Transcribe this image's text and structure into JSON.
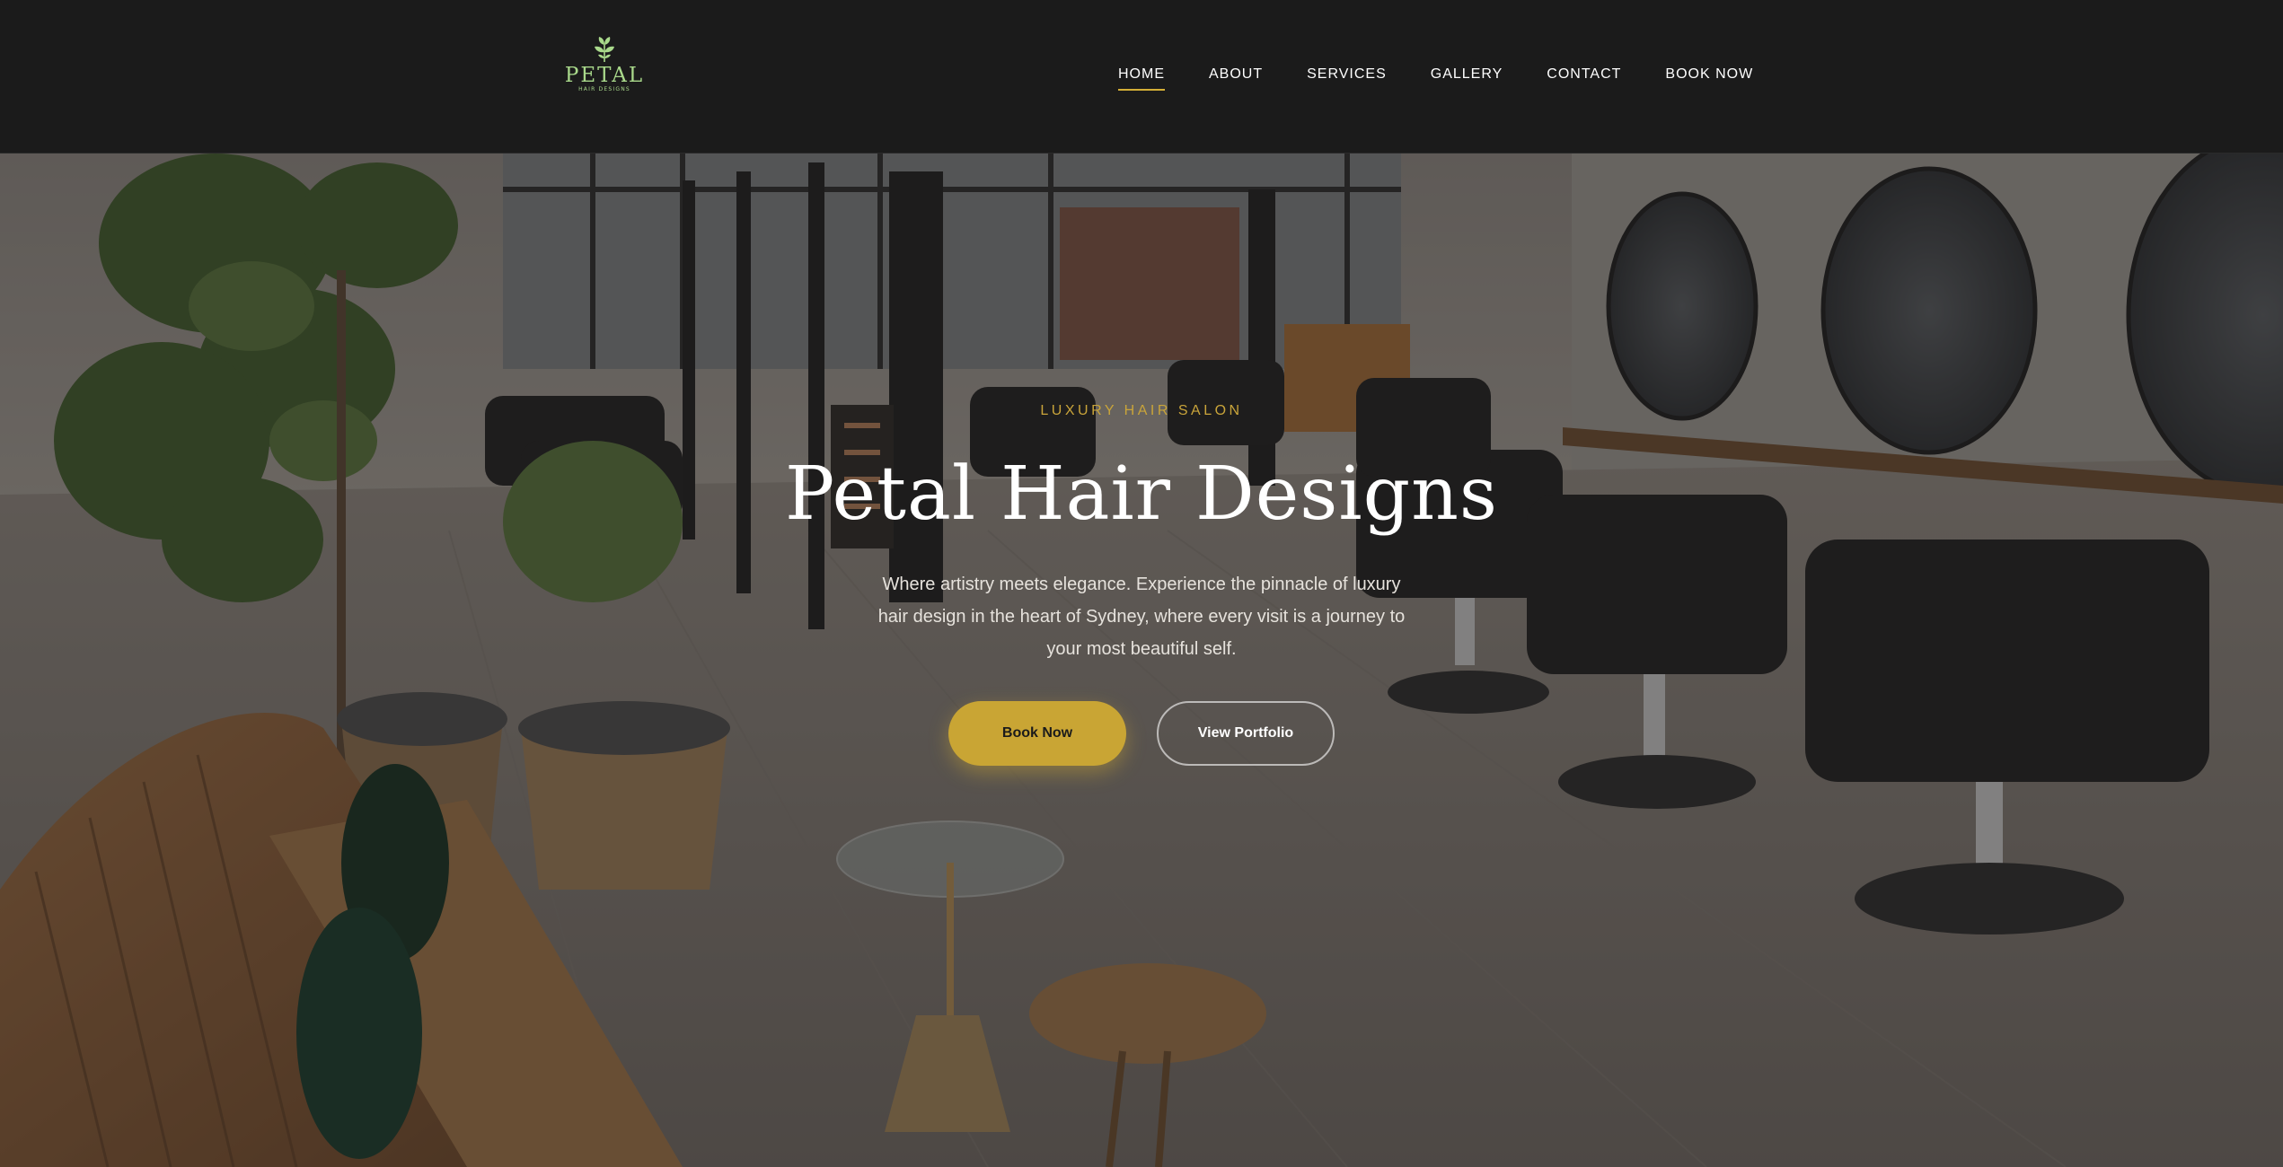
{
  "brand": {
    "name": "PETAL",
    "tagline": "HAIR DESIGNS",
    "logo_icon": "leaf-sprig-icon",
    "color": "#a9d98b"
  },
  "nav": {
    "items": [
      {
        "label": "HOME",
        "active": true
      },
      {
        "label": "ABOUT",
        "active": false
      },
      {
        "label": "SERVICES",
        "active": false
      },
      {
        "label": "GALLERY",
        "active": false
      },
      {
        "label": "CONTACT",
        "active": false
      },
      {
        "label": "BOOK NOW",
        "active": false
      }
    ],
    "accent": "#d4af37"
  },
  "hero": {
    "eyebrow": "LUXURY HAIR SALON",
    "title": "Petal Hair Designs",
    "subtitle": "Where artistry meets elegance. Experience the pinnacle of luxury hair design in the heart of Sydney, where every visit is a journey to your most beautiful self.",
    "primary_button": "Book Now",
    "secondary_button": "View Portfolio",
    "background": "salon interior photo",
    "accent": "#c9a534"
  }
}
